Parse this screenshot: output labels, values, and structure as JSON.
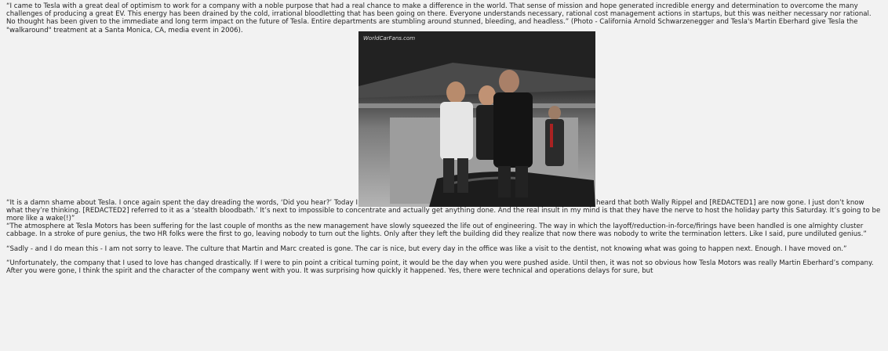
{
  "article": {
    "p1": "“I came to Tesla with a great deal of optimism to work for a company with a noble purpose that had a real chance to make a difference in the world. That sense of mission and hope generated incredible energy and determination to overcome the many challenges of producing a great EV. This energy has been drained by the cold, irrational bloodletting that has been going on there. Everyone understands necessary, rational cost management actions in startups, but this was neither necessary nor rational. No thought has been given to the immediate and long term impact on the future of Tesla. Entire departments are stumbling around stunned, bleeding, and headless.” (Photo - California Arnold Schwarzenegger and Tesla's Martin Eberhard give Tesla the \"walkaround\" treatment at a Santa Monica, CA, media event in 2006).",
    "p2_before": "“It is a damn shame about Tesla. I once again spent the day dreading the words, ‘Did you hear?’ Today I",
    "p2_after": "heard that both Wally Rippel and [REDACTED1] are now gone. I just don’t know what they’re thinking. [REDACTED2] referred to it as a ‘stealth bloodbath.’ It’s next to impossible to concentrate and actually get anything done. And the real insult in my mind is that they have the nerve to host the holiday party this Saturday. It’s going to be more like a wake(!)”",
    "p3": "“The atmosphere at Tesla Motors has been suffering for the last couple of months as the new management have slowly squeezed the life out of engineering. The way in which the layoff/reduction-in-force/firings have been handled is one almighty cluster cabbage. In a stroke of pure genius, the two HR folks were the first to go, leaving nobody to turn out the lights. Only after they left the building did they realize that now there was nobody to write the termination letters. Like I said, pure undiluted genius.”",
    "p4": "“Sadly - and I do mean this - I am not sorry to leave. The culture that Martin and Marc created is gone. The car is nice, but every day in the office was like a visit to the dentist, not knowing what was going to happen next. Enough. I have moved on.”",
    "p5": "“Unfortunately, the company that I used to love has changed drastically. If I were to pin point a critical turning point, it would be the day when you were pushed aside. Until then, it was not so obvious how Tesla Motors was really Martin Eberhard’s company. After you were gone, I think the spirit and the character of the company went with you. It was surprising how quickly it happened. Yes, there were technical and operations delays for sure, but"
  },
  "photo": {
    "watermark": "WorldCarFans.com"
  }
}
